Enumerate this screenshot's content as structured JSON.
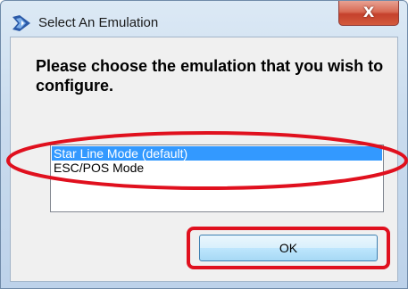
{
  "window": {
    "title": "Select An Emulation",
    "close_label": "X"
  },
  "dialog": {
    "prompt": "Please choose the emulation that you wish to configure.",
    "emulations": [
      {
        "label": "Star Line Mode (default)",
        "selected": true
      },
      {
        "label": "ESC/POS Mode",
        "selected": false
      }
    ],
    "ok_label": "OK"
  },
  "annotations": {
    "highlight_color": "#e0101e"
  },
  "colors": {
    "selection": "#3399ff",
    "dialog_background": "#f0f0f0"
  }
}
